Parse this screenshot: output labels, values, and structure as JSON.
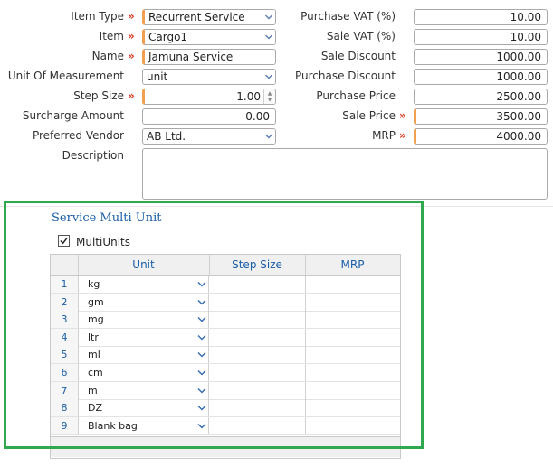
{
  "form": {
    "item_type": {
      "label": "Item Type",
      "value": "Recurrent Service"
    },
    "item": {
      "label": "Item",
      "value": "Cargo1"
    },
    "name": {
      "label": "Name",
      "value": "Jamuna Service"
    },
    "uom": {
      "label": "Unit Of Measurement",
      "value": "unit"
    },
    "step_size": {
      "label": "Step Size",
      "value": "1.00"
    },
    "surcharge": {
      "label": "Surcharge Amount",
      "value": "0.00"
    },
    "vendor": {
      "label": "Preferred Vendor",
      "value": "AB Ltd."
    },
    "description": {
      "label": "Description",
      "value": ""
    },
    "purchase_vat": {
      "label": "Purchase VAT (%)",
      "value": "10.00"
    },
    "sale_vat": {
      "label": "Sale VAT (%)",
      "value": "10.00"
    },
    "sale_discount": {
      "label": "Sale Discount",
      "value": "1000.00"
    },
    "purchase_discount": {
      "label": "Purchase Discount",
      "value": "1000.00"
    },
    "purchase_price": {
      "label": "Purchase Price",
      "value": "2500.00"
    },
    "sale_price": {
      "label": "Sale Price",
      "value": "3500.00"
    },
    "mrp": {
      "label": "MRP",
      "value": "4000.00"
    },
    "required_marker": "»"
  },
  "multi_unit": {
    "title": "Service Multi Unit",
    "checkbox_label": "MultiUnits",
    "checkbox_checked": true,
    "columns": [
      "Unit",
      "Step Size",
      "MRP"
    ],
    "rows": [
      {
        "num": "1",
        "unit": "kg"
      },
      {
        "num": "2",
        "unit": "gm"
      },
      {
        "num": "3",
        "unit": "mg"
      },
      {
        "num": "4",
        "unit": "ltr"
      },
      {
        "num": "5",
        "unit": "ml"
      },
      {
        "num": "6",
        "unit": "cm"
      },
      {
        "num": "7",
        "unit": "m"
      },
      {
        "num": "8",
        "unit": "DZ"
      },
      {
        "num": "9",
        "unit": "Blank bag"
      }
    ]
  },
  "colors": {
    "highlight_border": "#2fa84f",
    "accent_text": "#1a5ea8",
    "required": "#d9381e"
  }
}
